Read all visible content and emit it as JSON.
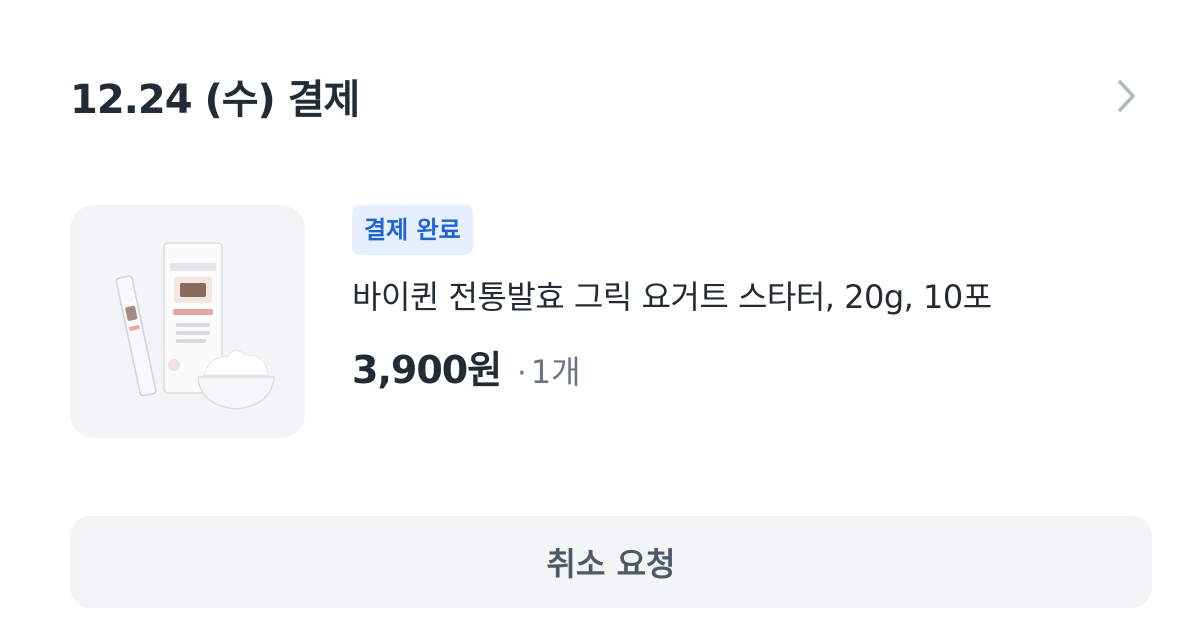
{
  "order": {
    "title": "12.24 (수) 결제",
    "status": "결제 완료",
    "product_name": "바이퀸 전통발효 그릭 요거트 스타터, 20g, 10포",
    "price": "3,900원",
    "separator": "·",
    "quantity": "1개",
    "cancel_label": "취소 요청"
  },
  "icons": {
    "detail": "chevron-right-icon",
    "product": "product-thumbnail-image"
  },
  "colors": {
    "badge_bg": "#e6efff",
    "badge_text": "#1e63d6",
    "text_primary": "#222b36",
    "text_secondary": "#6b7684",
    "button_bg": "#f2f4f6"
  }
}
